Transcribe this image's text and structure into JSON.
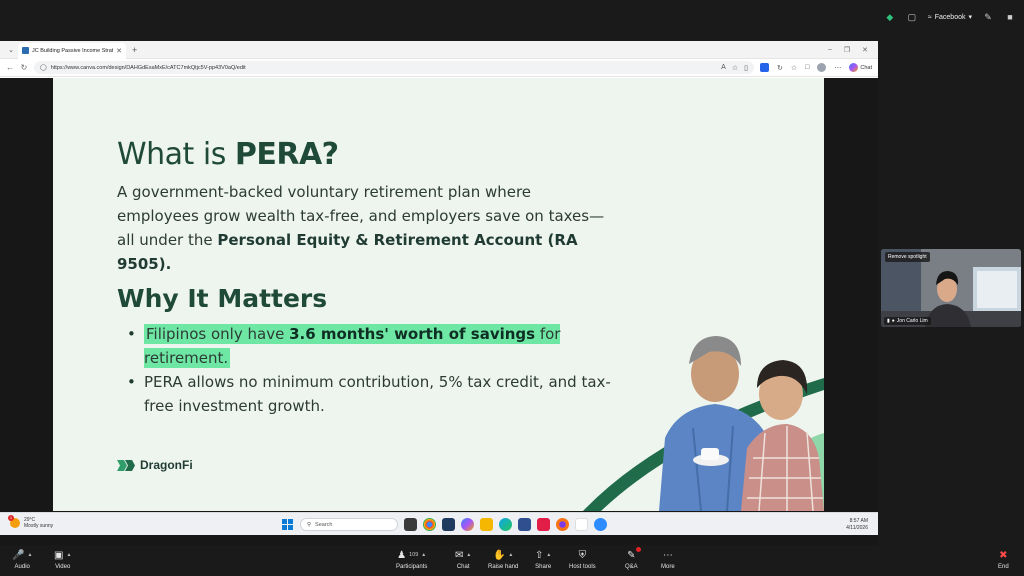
{
  "zoom_top": {
    "meeting_label": "Facebook",
    "icons": [
      "shield-icon",
      "fullscreen-icon",
      "facebook-live-icon",
      "pen-icon",
      "exit-fullscreen-icon"
    ]
  },
  "browser": {
    "tab_title": "JC Building Passive Income Strat...",
    "url": "https://www.canva.com/design/DAHGdEsaMxE/cATC7mkQtjc5V-pp43V0aQ/edit",
    "chat_label": "Chat"
  },
  "slide": {
    "title_prefix": "What is ",
    "title_bold": "PERA?",
    "intro_text": "A government-backed voluntary retirement plan where employees grow wealth tax-free, and employers save on taxes—all under the ",
    "intro_bold": "Personal Equity & Retirement Account (RA 9505).",
    "section_title": "Why It Matters",
    "bullet1_pre": "Filipinos only have ",
    "bullet1_bold": "3.6 months' worth of savings",
    "bullet1_post": " for retirement.",
    "bullet2": "PERA allows no minimum contribution, 5% tax credit, and tax-free investment growth.",
    "logo_text": "DragonFi",
    "accent_color": "#6ee7a4",
    "title_color": "#1f4a3a"
  },
  "taskbar": {
    "temperature": "29°C",
    "weather": "Mostly sunny",
    "weather_badge": "1",
    "search_placeholder": "Search",
    "time": "8:57 AM",
    "date": "4/11/2026"
  },
  "participant": {
    "spotlight_label": "Remove spotlight",
    "name": "Jon Carlo Lim"
  },
  "zoom_bottom": {
    "audio": "Audio",
    "video": "Video",
    "participants": "Participants",
    "participant_count": "109",
    "chat": "Chat",
    "raise_hand": "Raise hand",
    "share": "Share",
    "host_tools": "Host tools",
    "qa": "Q&A",
    "more": "More",
    "end": "End"
  }
}
